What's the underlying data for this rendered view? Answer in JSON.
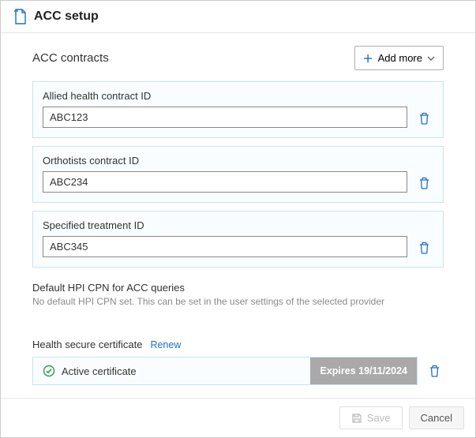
{
  "header": {
    "title": "ACC setup"
  },
  "contracts_section": {
    "title": "ACC contracts",
    "add_more_label": "Add more"
  },
  "contracts": [
    {
      "label": "Allied health contract ID",
      "value": "ABC123"
    },
    {
      "label": "Orthotists contract ID",
      "value": "ABC234"
    },
    {
      "label": "Specified treatment ID",
      "value": "ABC345"
    }
  ],
  "hpi": {
    "label": "Default HPI CPN for ACC queries",
    "helper": "No default HPI CPN set. This can be set in the user settings of the selected provider"
  },
  "certificate": {
    "label": "Health secure certificate",
    "renew": "Renew",
    "status": "Active certificate",
    "expires": "Expires 19/11/2024"
  },
  "footer": {
    "save": "Save",
    "cancel": "Cancel"
  }
}
